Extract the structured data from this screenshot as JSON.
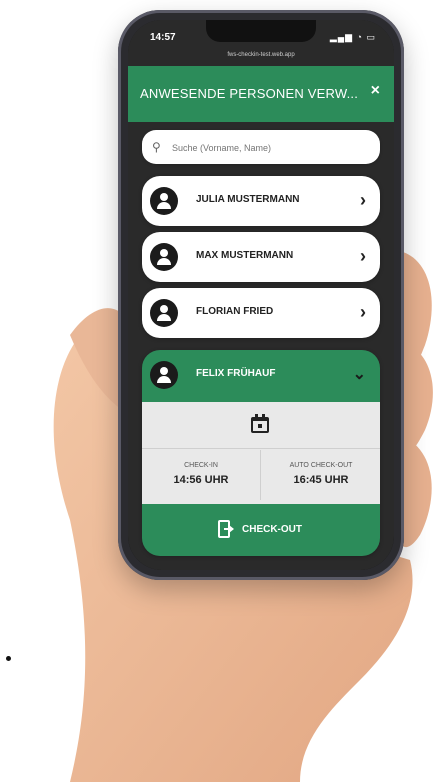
{
  "statusbar": {
    "time": "14:57",
    "url": "fws-checkin-test.web.app"
  },
  "header": {
    "title": "ANWESENDE PERSONEN VERW...",
    "close_label": "×"
  },
  "search": {
    "placeholder": "Suche (Vorname, Name)"
  },
  "people": [
    {
      "name": "JULIA MUSTERMANN"
    },
    {
      "name": "MAX MUSTERMANN"
    },
    {
      "name": "FLORIAN FRIED"
    },
    {
      "name": "FELIX FRÜHAUF"
    }
  ],
  "selected": {
    "checkin_label": "CHECK-IN",
    "checkin_time": "14:56 UHR",
    "auto_checkout_label": "AUTO CHECK-OUT",
    "auto_checkout_time": "16:45 UHR",
    "checkout_button": "CHECK-OUT"
  },
  "colors": {
    "accent": "#2c8c5a",
    "dark_bg": "#2a2a2a"
  }
}
